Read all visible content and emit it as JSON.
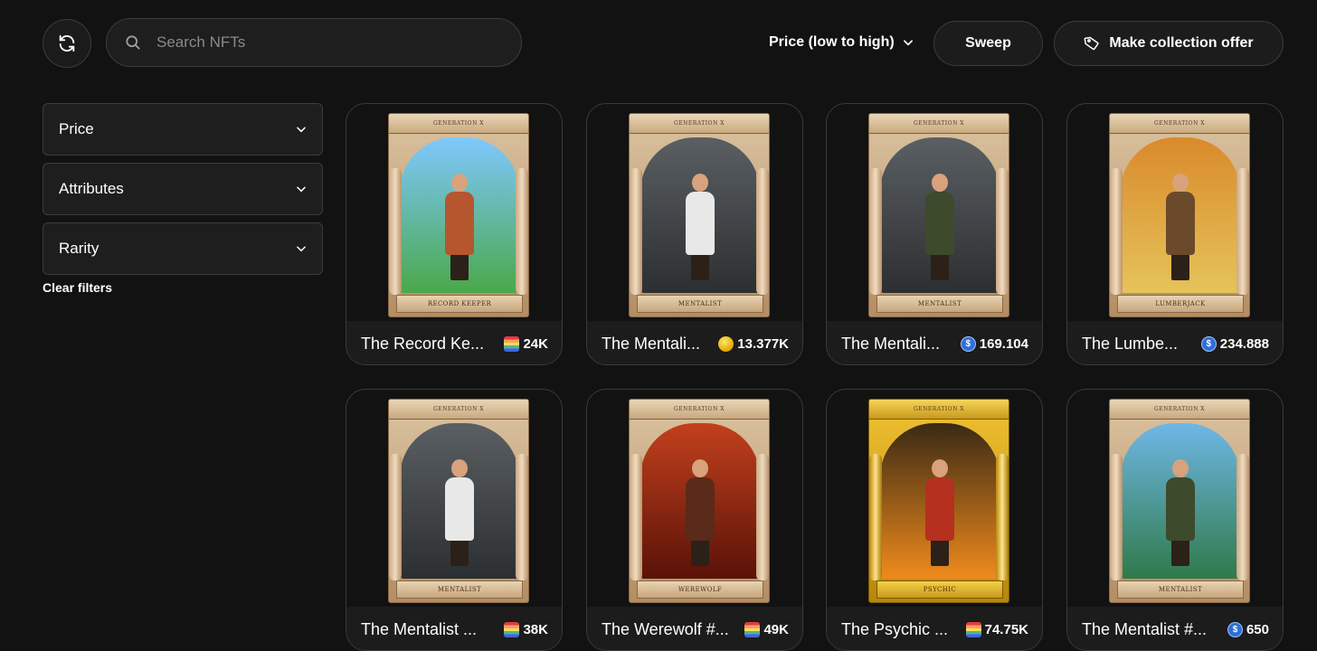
{
  "toolbar": {
    "search_placeholder": "Search NFTs",
    "sort_label": "Price (low to high)",
    "sweep_label": "Sweep",
    "offer_label": "Make collection offer"
  },
  "filters": {
    "items": [
      {
        "label": "Price"
      },
      {
        "label": "Attributes"
      },
      {
        "label": "Rarity"
      }
    ],
    "clear_label": "Clear filters"
  },
  "cards": [
    {
      "name": "The Record Ke...",
      "price": "24K",
      "token": "stripe-token-icon",
      "plaque": "RECORD KEEPER",
      "gen": "GENERATION X",
      "scene": [
        "#7ec8ff",
        "#4aa84a"
      ],
      "outfit": "#b5562f",
      "frame": "stone"
    },
    {
      "name": "The Mentali...",
      "price": "13.377K",
      "token": "gold-coin-icon",
      "plaque": "MENTALIST",
      "gen": "GENERATION X",
      "scene": [
        "#5a5f63",
        "#2c2f31"
      ],
      "outfit": "#e8e8e8",
      "frame": "stone"
    },
    {
      "name": "The Mentali...",
      "price": "169.104",
      "token": "usdc-token-icon",
      "plaque": "MENTALIST",
      "gen": "GENERATION X",
      "scene": [
        "#5a5f63",
        "#2c2f31"
      ],
      "outfit": "#3e4a2c",
      "frame": "stone"
    },
    {
      "name": "The Lumbe...",
      "price": "234.888",
      "token": "usdc-token-icon",
      "plaque": "LUMBERJACK",
      "gen": "GENERATION X",
      "scene": [
        "#d98a2b",
        "#e6c35a"
      ],
      "outfit": "#6b4a2c",
      "frame": "stone"
    },
    {
      "name": "The Mentalist ...",
      "price": "38K",
      "token": "stripe-token-icon",
      "plaque": "MENTALIST",
      "gen": "GENERATION X",
      "scene": [
        "#5a5f63",
        "#2c2f31"
      ],
      "outfit": "#e8e8e8",
      "frame": "stone"
    },
    {
      "name": "The Werewolf #...",
      "price": "49K",
      "token": "stripe-token-icon",
      "plaque": "WEREWOLF",
      "gen": "GENERATION X",
      "scene": [
        "#c2401c",
        "#5a1208"
      ],
      "outfit": "#5a2a1a",
      "frame": "stone"
    },
    {
      "name": "The Psychic ...",
      "price": "74.75K",
      "token": "stripe-token-icon",
      "plaque": "PSYCHIC",
      "gen": "GENERATION X",
      "scene": [
        "#3a2a14",
        "#f08a1c"
      ],
      "outfit": "#b5301f",
      "frame": "gold"
    },
    {
      "name": "The Mentalist #...",
      "price": "650",
      "token": "usdc-token-icon",
      "plaque": "MENTALIST",
      "gen": "GENERATION X",
      "scene": [
        "#6fb7e6",
        "#2f7a4a"
      ],
      "outfit": "#3e4a2c",
      "frame": "stone"
    }
  ]
}
